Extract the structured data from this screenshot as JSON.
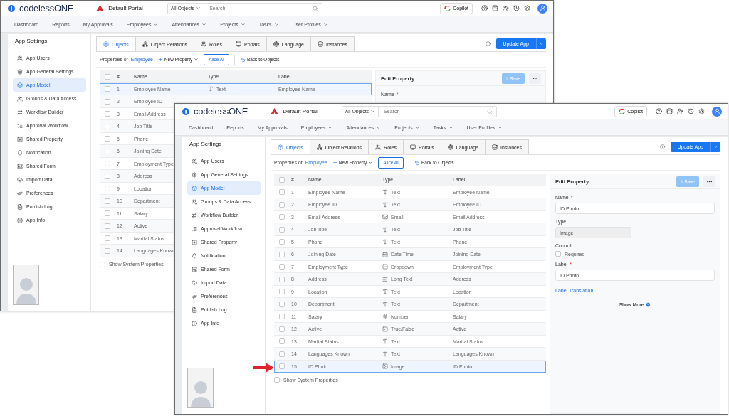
{
  "windows": [
    {
      "logo": "codelessONE",
      "portal": "Default Portal",
      "search": {
        "scope": "All Objects",
        "placeholder": "Search"
      },
      "copilot": "Copilot",
      "nav": [
        {
          "label": "Dashboard",
          "menu": false
        },
        {
          "label": "Reports",
          "menu": false
        },
        {
          "label": "My Approvals",
          "menu": false
        },
        {
          "label": "Employees",
          "menu": true
        },
        {
          "label": "Attendances",
          "menu": true
        },
        {
          "label": "Projects",
          "menu": true
        },
        {
          "label": "Tasks",
          "menu": true
        },
        {
          "label": "User Profiles",
          "menu": true
        }
      ],
      "sidebar": {
        "title": "App Settings",
        "items": [
          {
            "label": "App Users",
            "selected": false
          },
          {
            "label": "App General Settings",
            "selected": false
          },
          {
            "label": "App Model",
            "selected": true
          },
          {
            "label": "Groups & Data Access",
            "selected": false
          },
          {
            "label": "Workflow Builder",
            "selected": false
          },
          {
            "label": "Approval Workflow",
            "selected": false
          },
          {
            "label": "Shared Property",
            "selected": false
          },
          {
            "label": "Notification",
            "selected": false
          },
          {
            "label": "Shared Form",
            "selected": false
          },
          {
            "label": "Import Data",
            "selected": false
          },
          {
            "label": "Preferences",
            "selected": false
          },
          {
            "label": "Publish Log",
            "selected": false
          },
          {
            "label": "App Info",
            "selected": false
          }
        ]
      },
      "tabs": [
        {
          "label": "Objects",
          "selected": true
        },
        {
          "label": "Object Relations",
          "selected": false
        },
        {
          "label": "Roles",
          "selected": false
        },
        {
          "label": "Portals",
          "selected": false
        },
        {
          "label": "Language",
          "selected": false
        },
        {
          "label": "Instances",
          "selected": false
        }
      ],
      "update_button": "Update App",
      "toolbar": {
        "prefix": "Properties of",
        "object": "Employee",
        "new_property": "New Property",
        "ai_button": "Alice AI",
        "back": "Back to Objects"
      },
      "table": {
        "columns": [
          "#",
          "Name",
          "Type",
          "Label"
        ],
        "header_checked": false,
        "rows": [
          {
            "number": "1",
            "name": "Employee Name",
            "type": "Text",
            "kind": "text",
            "label": "Employee Name",
            "checked": false,
            "selected": true
          },
          {
            "number": "2",
            "name": "Employee ID",
            "checked": false,
            "selected": false
          },
          {
            "number": "3",
            "name": "Email Address",
            "checked": false,
            "selected": false
          },
          {
            "number": "4",
            "name": "Job Title",
            "checked": false,
            "selected": false
          },
          {
            "number": "5",
            "name": "Phone",
            "checked": false,
            "selected": false
          },
          {
            "number": "6",
            "name": "Joining Date",
            "checked": false,
            "selected": false
          },
          {
            "number": "7",
            "name": "Employment Type",
            "checked": false,
            "selected": false
          },
          {
            "number": "8",
            "name": "Address",
            "checked": false,
            "selected": false
          },
          {
            "number": "9",
            "name": "Location",
            "checked": false,
            "selected": false
          },
          {
            "number": "10",
            "name": "Department",
            "checked": false,
            "selected": false
          },
          {
            "number": "11",
            "name": "Salary",
            "checked": false,
            "selected": false
          },
          {
            "number": "12",
            "name": "Active",
            "checked": false,
            "selected": false
          },
          {
            "number": "13",
            "name": "Marital Status",
            "checked": false,
            "selected": false
          },
          {
            "number": "14",
            "name": "Languages Known",
            "checked": false,
            "selected": false
          }
        ]
      },
      "show_system": {
        "label": "Show System Properties",
        "checked": false
      },
      "edit_panel": {
        "title": "Edit Property",
        "save": {
          "label": "Save",
          "disabled": true
        },
        "fields": [
          {
            "kind": "input",
            "label": "Name",
            "required_mark": "*"
          }
        ]
      }
    },
    {
      "logo": "codelessONE",
      "portal": "Default Portal",
      "search": {
        "scope": "All Objects",
        "placeholder": "Search"
      },
      "copilot": "Copilot",
      "nav": [
        {
          "label": "Dashboard",
          "menu": false
        },
        {
          "label": "Reports",
          "menu": false
        },
        {
          "label": "My Approvals",
          "menu": false
        },
        {
          "label": "Employees",
          "menu": true
        },
        {
          "label": "Attendances",
          "menu": true
        },
        {
          "label": "Projects",
          "menu": true
        },
        {
          "label": "Tasks",
          "menu": true
        },
        {
          "label": "User Profiles",
          "menu": true
        }
      ],
      "sidebar": {
        "title": "App Settings",
        "items": [
          {
            "label": "App Users",
            "selected": false
          },
          {
            "label": "App General Settings",
            "selected": false
          },
          {
            "label": "App Model",
            "selected": true
          },
          {
            "label": "Groups & Data Access",
            "selected": false
          },
          {
            "label": "Workflow Builder",
            "selected": false
          },
          {
            "label": "Approval Workflow",
            "selected": false
          },
          {
            "label": "Shared Property",
            "selected": false
          },
          {
            "label": "Notification",
            "selected": false
          },
          {
            "label": "Shared Form",
            "selected": false
          },
          {
            "label": "Import Data",
            "selected": false
          },
          {
            "label": "Preferences",
            "selected": false
          },
          {
            "label": "Publish Log",
            "selected": false
          },
          {
            "label": "App Info",
            "selected": false
          }
        ]
      },
      "tabs": [
        {
          "label": "Objects",
          "selected": true
        },
        {
          "label": "Object Relations",
          "selected": false
        },
        {
          "label": "Roles",
          "selected": false
        },
        {
          "label": "Portals",
          "selected": false
        },
        {
          "label": "Language",
          "selected": false
        },
        {
          "label": "Instances",
          "selected": false
        }
      ],
      "update_button": "Update App",
      "toolbar": {
        "prefix": "Properties of",
        "object": "Employee",
        "new_property": "New Property",
        "ai_button": "Alice AI",
        "back": "Back to Objects"
      },
      "table": {
        "columns": [
          "#",
          "Name",
          "Type",
          "Label"
        ],
        "header_checked": false,
        "rows": [
          {
            "number": "1",
            "name": "Employee Name",
            "type": "Text",
            "kind": "text",
            "label": "Employee Name",
            "checked": false,
            "selected": false
          },
          {
            "number": "2",
            "name": "Employee ID",
            "type": "Text",
            "kind": "text",
            "label": "Employee ID",
            "checked": false,
            "selected": false
          },
          {
            "number": "3",
            "name": "Email Address",
            "type": "Email",
            "kind": "email",
            "label": "Email Address",
            "checked": false,
            "selected": false
          },
          {
            "number": "4",
            "name": "Job Title",
            "type": "Text",
            "kind": "text",
            "label": "Job Title",
            "checked": false,
            "selected": false
          },
          {
            "number": "5",
            "name": "Phone",
            "type": "Text",
            "kind": "text",
            "label": "Phone",
            "checked": false,
            "selected": false
          },
          {
            "number": "6",
            "name": "Joining Date",
            "type": "Date Time",
            "kind": "datetime",
            "label": "Joining Date",
            "checked": false,
            "selected": false
          },
          {
            "number": "7",
            "name": "Employment Type",
            "type": "Dropdown",
            "kind": "dropdown",
            "label": "Employment Type",
            "checked": false,
            "selected": false
          },
          {
            "number": "8",
            "name": "Address",
            "type": "Long Text",
            "kind": "longtext",
            "label": "Address",
            "checked": false,
            "selected": false
          },
          {
            "number": "9",
            "name": "Location",
            "type": "Text",
            "kind": "text",
            "label": "Location",
            "checked": false,
            "selected": false
          },
          {
            "number": "10",
            "name": "Department",
            "type": "Text",
            "kind": "text",
            "label": "Department",
            "checked": false,
            "selected": false
          },
          {
            "number": "11",
            "name": "Salary",
            "type": "Number",
            "kind": "number",
            "label": "Salary",
            "checked": false,
            "selected": false
          },
          {
            "number": "12",
            "name": "Active",
            "type": "True/False",
            "kind": "boolean",
            "label": "Active",
            "checked": false,
            "selected": false
          },
          {
            "number": "13",
            "name": "Marital Status",
            "type": "Text",
            "kind": "text",
            "label": "Marital Status",
            "checked": false,
            "selected": false
          },
          {
            "number": "14",
            "name": "Languages Known",
            "type": "Text",
            "kind": "text",
            "label": "Languages Known",
            "checked": false,
            "selected": false
          },
          {
            "number": "15",
            "name": "ID Photo",
            "type": "Image",
            "kind": "image",
            "label": "ID Photo",
            "checked": false,
            "selected": true
          }
        ]
      },
      "show_system": {
        "label": "Show System Properties",
        "checked": false
      },
      "edit_panel": {
        "title": "Edit Property",
        "save": {
          "label": "Save",
          "disabled": true
        },
        "fields": [
          {
            "kind": "input",
            "label": "Name",
            "required_mark": "*",
            "value": "ID Photo"
          },
          {
            "kind": "readonly",
            "label": "Type",
            "value": "Image"
          },
          {
            "kind": "checkbox",
            "label": "Control",
            "option": "Required",
            "checked": false
          },
          {
            "kind": "input",
            "label": "Label",
            "required_mark": "*",
            "value": "ID Photo"
          }
        ],
        "link": "Label Translation",
        "show_more": "Show More"
      }
    }
  ]
}
